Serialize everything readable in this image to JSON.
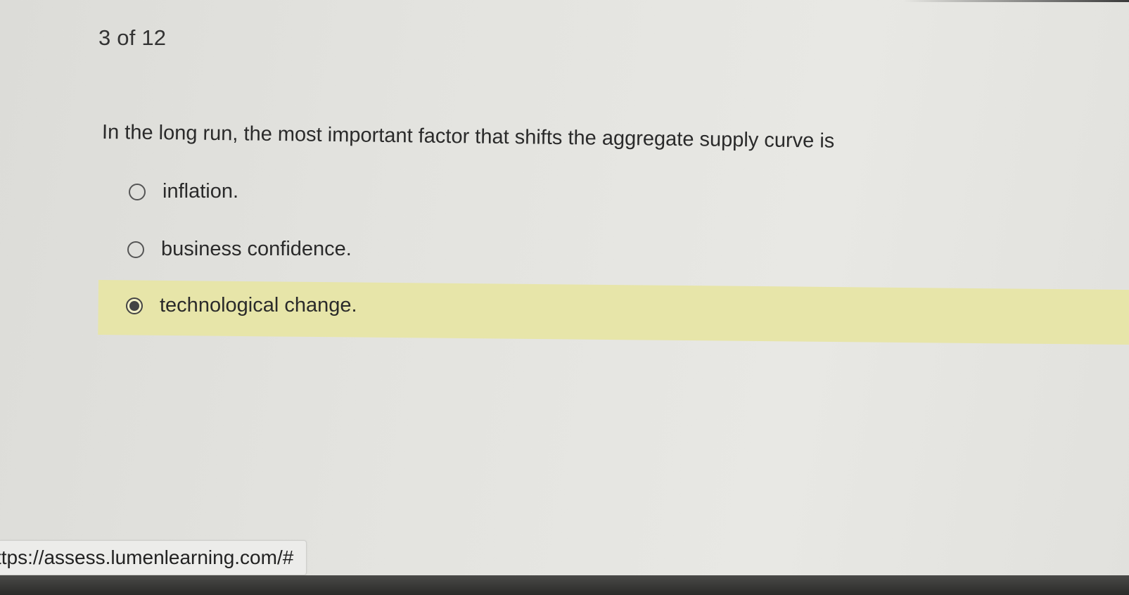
{
  "quiz": {
    "counter": "3 of 12",
    "question": "In the long run, the most important factor that shifts the aggregate supply curve is",
    "options": [
      {
        "label": "inflation.",
        "selected": false
      },
      {
        "label": "business confidence.",
        "selected": false
      },
      {
        "label": "technological change.",
        "selected": true
      }
    ]
  },
  "status_bar": {
    "url": "ttps://assess.lumenlearning.com/#"
  },
  "colors": {
    "selected_highlight": "#e7e5a9",
    "background": "#e3e3df",
    "text": "#2a2a2a"
  },
  "icons": {
    "unselected": "radio-empty-icon",
    "selected": "radio-filled-icon"
  }
}
